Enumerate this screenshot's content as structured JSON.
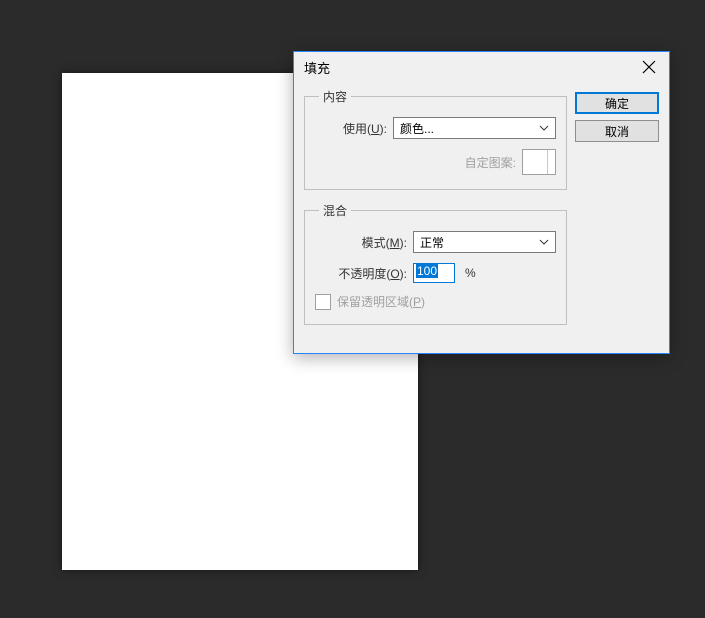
{
  "dialog": {
    "title": "填充",
    "content_group": {
      "legend": "内容",
      "use_label_pre": "使用(",
      "use_key": "U",
      "use_label_post": "):",
      "use_value": "颜色...",
      "pattern_label": "自定图案:"
    },
    "blend_group": {
      "legend": "混合",
      "mode_label_pre": "模式(",
      "mode_key": "M",
      "mode_label_post": "):",
      "mode_value": "正常",
      "opacity_label_pre": "不透明度(",
      "opacity_key": "O",
      "opacity_label_post": "):",
      "opacity_value": "100",
      "opacity_unit": "%",
      "preserve_label_pre": "保留透明区域(",
      "preserve_key": "P",
      "preserve_label_post": ")"
    },
    "buttons": {
      "ok": "确定",
      "cancel": "取消"
    }
  }
}
